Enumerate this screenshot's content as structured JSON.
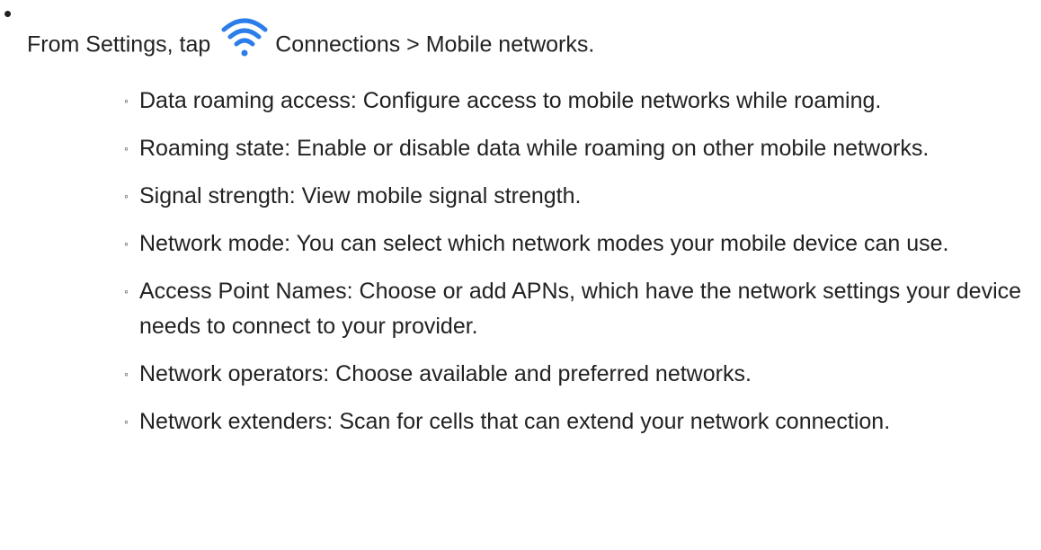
{
  "intro": {
    "bullet": "•",
    "prefix": "From Settings, tap",
    "suffix": "Connections > Mobile networks.",
    "icon": "wifi-icon",
    "icon_color": "#2b7de9"
  },
  "items": [
    {
      "marker": "◦",
      "text": "Data roaming access: Configure access to mobile networks while roaming."
    },
    {
      "marker": "◦",
      "text": "Roaming state: Enable or disable data while roaming on other mobile networks."
    },
    {
      "marker": "◦",
      "text": "Signal strength: View mobile signal strength."
    },
    {
      "marker": "◦",
      "text": "Network mode: You can select which network modes your mobile device can use."
    },
    {
      "marker": "◦",
      "text": "Access Point Names: Choose or add APNs, which have the network settings your device needs to connect to your provider."
    },
    {
      "marker": "◦",
      "text": "Network operators: Choose available and preferred networks."
    },
    {
      "marker": "◦",
      "text": "Network extenders: Scan for cells that can extend your network connection."
    }
  ]
}
